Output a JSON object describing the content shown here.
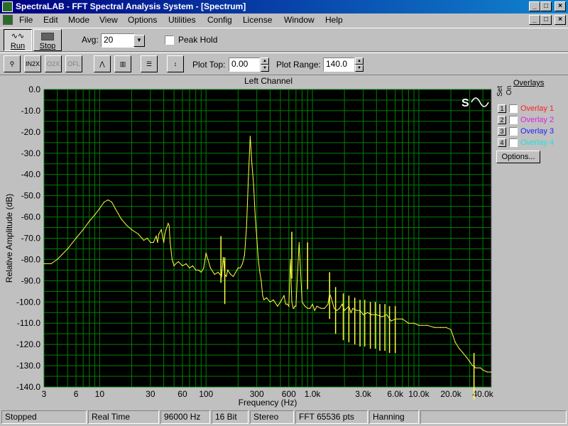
{
  "window": {
    "title": "SpectraLAB - FFT Spectral Analysis System - [Spectrum]"
  },
  "menu": [
    "File",
    "Edit",
    "Mode",
    "View",
    "Options",
    "Utilities",
    "Config",
    "License",
    "Window",
    "Help"
  ],
  "toolbar": {
    "run_label": "Run",
    "stop_label": "Stop",
    "avg_label": "Avg:",
    "avg_value": "20",
    "peak_hold_label": "Peak Hold",
    "plot_top_label": "Plot Top:",
    "plot_top_value": "0.00",
    "plot_range_label": "Plot Range:",
    "plot_range_value": "140.0"
  },
  "overlays": {
    "title": "Overlays",
    "set_label": "Set",
    "on_label": "On",
    "items": [
      {
        "num": "1",
        "label": "Overlay 1",
        "color": "#ff2020"
      },
      {
        "num": "2",
        "label": "Overlay 2",
        "color": "#e020e0"
      },
      {
        "num": "3",
        "label": "Overlay 3",
        "color": "#2020ff"
      },
      {
        "num": "4",
        "label": "Overlay 4",
        "color": "#20e0e0"
      }
    ],
    "options_label": "Options..."
  },
  "status": [
    "Stopped",
    "Real Time",
    "96000 Hz",
    "16 Bit",
    "Stereo",
    "FFT 65536 pts",
    "Hanning"
  ],
  "chart_data": {
    "type": "line",
    "title": "Left Channel",
    "xlabel": "Frequency (Hz)",
    "ylabel": "Relative Amplitude (dB)",
    "x_scale": "log",
    "xlim": [
      3,
      48000
    ],
    "ylim": [
      -140,
      0
    ],
    "grid": true,
    "background": "#000000",
    "grid_color": "#008000",
    "line_color": "#ffff40",
    "x_ticks": [
      {
        "value": 3,
        "label": "3"
      },
      {
        "value": 6,
        "label": "6"
      },
      {
        "value": 10,
        "label": "10"
      },
      {
        "value": 30,
        "label": "30"
      },
      {
        "value": 60,
        "label": "60"
      },
      {
        "value": 100,
        "label": "100"
      },
      {
        "value": 300,
        "label": "300"
      },
      {
        "value": 600,
        "label": "600"
      },
      {
        "value": 1000,
        "label": "1.0k"
      },
      {
        "value": 3000,
        "label": "3.0k"
      },
      {
        "value": 6000,
        "label": "6.0k"
      },
      {
        "value": 10000,
        "label": "10.0k"
      },
      {
        "value": 20000,
        "label": "20.0k"
      },
      {
        "value": 40000,
        "label": "40.0k"
      }
    ],
    "y_ticks": [
      {
        "value": 0,
        "label": "0.0"
      },
      {
        "value": -10,
        "label": "-10.0"
      },
      {
        "value": -20,
        "label": "-20.0"
      },
      {
        "value": -30,
        "label": "-30.0"
      },
      {
        "value": -40,
        "label": "-40.0"
      },
      {
        "value": -50,
        "label": "-50.0"
      },
      {
        "value": -60,
        "label": "-60.0"
      },
      {
        "value": -70,
        "label": "-70.0"
      },
      {
        "value": -80,
        "label": "-80.0"
      },
      {
        "value": -90,
        "label": "-90.0"
      },
      {
        "value": -100,
        "label": "-100.0"
      },
      {
        "value": -110,
        "label": "-110.0"
      },
      {
        "value": -120,
        "label": "-120.0"
      },
      {
        "value": -130,
        "label": "-130.0"
      },
      {
        "value": -140,
        "label": "-140.0"
      }
    ],
    "series": [
      {
        "x": [
          3,
          3.5,
          4,
          5,
          6,
          7,
          8,
          9,
          10,
          11,
          12,
          13,
          14,
          16,
          18,
          20,
          23,
          26,
          28,
          30,
          32,
          34,
          35,
          36,
          38,
          40,
          41,
          42,
          44,
          45,
          46,
          48,
          50,
          52,
          55,
          60,
          65,
          70,
          75,
          80,
          85,
          90,
          95,
          100,
          110,
          120,
          130,
          140,
          145,
          150,
          155,
          160,
          170,
          180,
          190,
          200,
          210,
          220,
          230,
          240,
          250,
          260,
          270,
          280,
          290,
          300,
          310,
          320,
          330,
          340,
          350,
          370,
          400,
          430,
          470,
          500,
          540,
          560,
          580,
          600,
          620,
          640,
          660,
          670,
          680,
          700,
          750,
          800,
          850,
          900,
          950,
          1000,
          1050,
          1100,
          1200,
          1300,
          1400,
          1450,
          1500,
          1600,
          1700,
          1800,
          1900,
          2000,
          2200,
          2300,
          2400,
          2600,
          2800,
          3000,
          3300,
          3600,
          4000,
          4500,
          5000,
          5500,
          6000,
          7000,
          8000,
          9000,
          10000,
          12000,
          14000,
          16000,
          18000,
          20000,
          21000,
          22000,
          24000,
          26000,
          28000,
          30000,
          32000,
          33000,
          34000,
          36000,
          38000,
          40000,
          44000,
          48000
        ],
        "y": [
          -82,
          -82,
          -80,
          -75,
          -70,
          -66,
          -62,
          -59,
          -56,
          -53,
          -52,
          -53,
          -56,
          -61,
          -64,
          -66,
          -68,
          -71,
          -70,
          -72,
          -72,
          -69,
          -72,
          -68,
          -66,
          -72,
          -68,
          -66,
          -63,
          -64,
          -72,
          -80,
          -83,
          -82,
          -81,
          -83,
          -82,
          -84,
          -83,
          -85,
          -85,
          -86,
          -84,
          -77,
          -84,
          -87,
          -86,
          -88,
          -79,
          -87,
          -88,
          -85,
          -87,
          -88,
          -86,
          -84,
          -84,
          -82,
          -78,
          -65,
          -42,
          -22,
          -35,
          -45,
          -60,
          -70,
          -80,
          -86,
          -90,
          -97,
          -99,
          -98,
          -100,
          -99,
          -102,
          -100,
          -97,
          -101,
          -101,
          -102,
          -80,
          -100,
          -103,
          -103,
          -102,
          -102,
          -72,
          -100,
          -102,
          -103,
          -103,
          -101,
          -104,
          -102,
          -103,
          -103,
          -101,
          -96,
          -98,
          -103,
          -104,
          -103,
          -101,
          -104,
          -102,
          -105,
          -103,
          -104,
          -104,
          -106,
          -105,
          -106,
          -106,
          -107,
          -106,
          -109,
          -108,
          -108,
          -110,
          -110,
          -111,
          -111,
          -112,
          -112,
          -112,
          -113,
          -116,
          -119,
          -122,
          -124,
          -126,
          -128,
          -130,
          -130,
          -131,
          -131,
          -131,
          -132,
          -133,
          -133
        ]
      }
    ],
    "spikes": [
      {
        "x": 138,
        "y": -69
      },
      {
        "x": 150,
        "y": -79
      },
      {
        "x": 640,
        "y": -67
      },
      {
        "x": 900,
        "y": -72
      },
      {
        "x": 1450,
        "y": -86
      },
      {
        "x": 1650,
        "y": -93
      },
      {
        "x": 1950,
        "y": -96
      },
      {
        "x": 2200,
        "y": -97
      },
      {
        "x": 2500,
        "y": -98
      },
      {
        "x": 2800,
        "y": -99
      },
      {
        "x": 3100,
        "y": -99
      },
      {
        "x": 3500,
        "y": -100
      },
      {
        "x": 3900,
        "y": -100
      },
      {
        "x": 4300,
        "y": -101
      },
      {
        "x": 4800,
        "y": -101
      },
      {
        "x": 5300,
        "y": -102
      },
      {
        "x": 6000,
        "y": -102
      },
      {
        "x": 33000,
        "y": -124
      }
    ]
  }
}
